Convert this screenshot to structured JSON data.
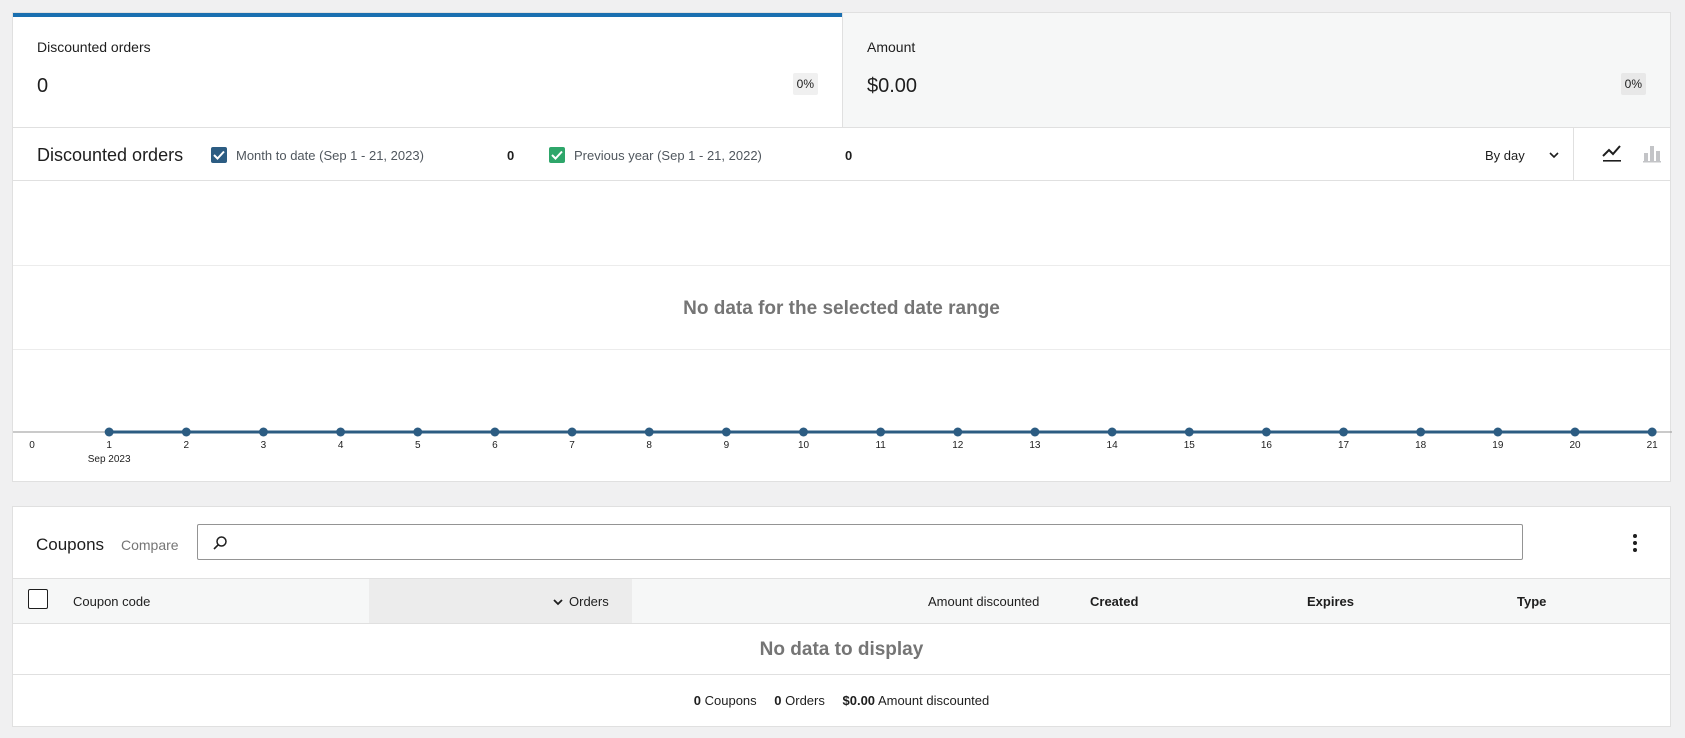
{
  "summary": {
    "cards": [
      {
        "label": "Discounted orders",
        "value": "0",
        "delta": "0%"
      },
      {
        "label": "Amount",
        "value": "$0.00",
        "delta": "0%"
      }
    ]
  },
  "chart_panel": {
    "title": "Discounted orders",
    "legend": [
      {
        "label": "Month to date (Sep 1 - 21, 2023)",
        "total": "0",
        "color": "#2c5c82",
        "checked": true
      },
      {
        "label": "Previous year (Sep 1 - 21, 2022)",
        "total": "0",
        "color": "#2ea66a",
        "checked": true
      }
    ],
    "interval_label": "By day",
    "chart_types": [
      "line-chart-icon",
      "bar-chart-icon"
    ],
    "empty_message": "No data for the selected date range",
    "x_month_label": "Sep 2023",
    "line_color": "#2c5c82"
  },
  "chart_data": {
    "type": "line",
    "title": "",
    "x": [
      "0",
      "1",
      "2",
      "3",
      "4",
      "5",
      "6",
      "7",
      "8",
      "9",
      "10",
      "11",
      "12",
      "13",
      "14",
      "15",
      "16",
      "17",
      "18",
      "19",
      "20",
      "21"
    ],
    "series": [
      {
        "name": "Month to date (Sep 1 - 21, 2023)",
        "values": [
          null,
          0,
          0,
          0,
          0,
          0,
          0,
          0,
          0,
          0,
          0,
          0,
          0,
          0,
          0,
          0,
          0,
          0,
          0,
          0,
          0,
          0
        ]
      }
    ],
    "xlabel": "",
    "ylabel": "",
    "grid": true
  },
  "table_panel": {
    "title": "Coupons",
    "compare_label": "Compare",
    "search_placeholder": "",
    "columns": [
      {
        "label": "Coupon code",
        "bold": false
      },
      {
        "label": "Orders",
        "bold": false,
        "sorted": true
      },
      {
        "label": "Amount discounted",
        "bold": false
      },
      {
        "label": "Created",
        "bold": true
      },
      {
        "label": "Expires",
        "bold": true
      },
      {
        "label": "Type",
        "bold": true
      }
    ],
    "empty_message": "No data to display",
    "summary": [
      {
        "value": "0",
        "label": "Coupons"
      },
      {
        "value": "0",
        "label": "Orders"
      },
      {
        "value": "$0.00",
        "label": "Amount discounted"
      }
    ]
  }
}
